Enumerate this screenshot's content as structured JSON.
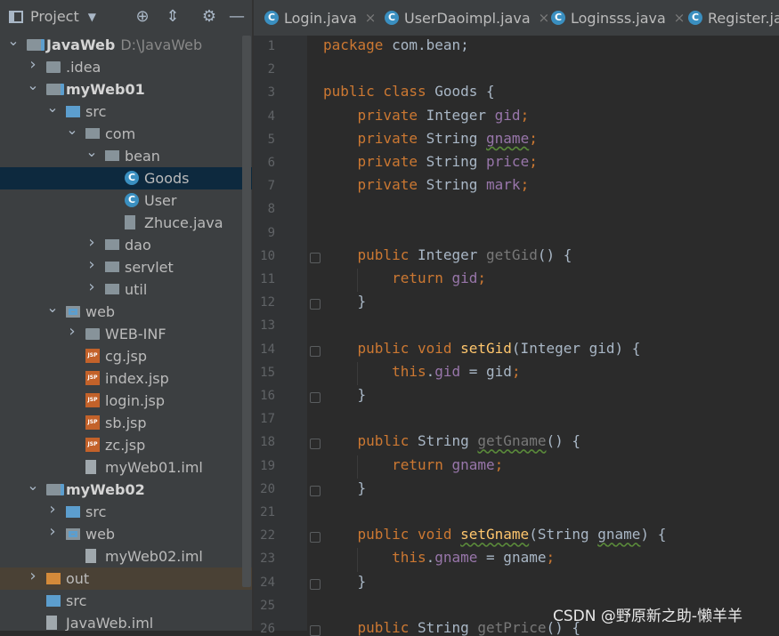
{
  "project_panel": {
    "title": "Project",
    "tree": [
      {
        "label": "JavaWeb",
        "path": "D:\\JavaWeb",
        "indent": 0,
        "expanded": true,
        "kind": "module-folder",
        "bold": true
      },
      {
        "label": ".idea",
        "indent": 1,
        "expanded": false,
        "kind": "folder"
      },
      {
        "label": "myWeb01",
        "indent": 1,
        "expanded": true,
        "kind": "module-folder",
        "bold": true
      },
      {
        "label": "src",
        "indent": 2,
        "expanded": true,
        "kind": "src-folder"
      },
      {
        "label": "com",
        "indent": 3,
        "expanded": true,
        "kind": "package"
      },
      {
        "label": "bean",
        "indent": 4,
        "expanded": true,
        "kind": "package"
      },
      {
        "label": "Goods",
        "indent": 5,
        "kind": "class",
        "selected": true
      },
      {
        "label": "User",
        "indent": 5,
        "kind": "class"
      },
      {
        "label": "Zhuce.java",
        "indent": 5,
        "kind": "java-file"
      },
      {
        "label": "dao",
        "indent": 4,
        "expanded": false,
        "kind": "package"
      },
      {
        "label": "servlet",
        "indent": 4,
        "expanded": false,
        "kind": "package"
      },
      {
        "label": "util",
        "indent": 4,
        "expanded": false,
        "kind": "package"
      },
      {
        "label": "web",
        "indent": 2,
        "expanded": true,
        "kind": "web-folder"
      },
      {
        "label": "WEB-INF",
        "indent": 3,
        "expanded": false,
        "kind": "folder"
      },
      {
        "label": "cg.jsp",
        "indent": 3,
        "kind": "jsp"
      },
      {
        "label": "index.jsp",
        "indent": 3,
        "kind": "jsp"
      },
      {
        "label": "login.jsp",
        "indent": 3,
        "kind": "jsp"
      },
      {
        "label": "sb.jsp",
        "indent": 3,
        "kind": "jsp"
      },
      {
        "label": "zc.jsp",
        "indent": 3,
        "kind": "jsp"
      },
      {
        "label": "myWeb01.iml",
        "indent": 3,
        "kind": "iml"
      },
      {
        "label": "myWeb02",
        "indent": 1,
        "expanded": true,
        "kind": "module-folder",
        "bold": true
      },
      {
        "label": "src",
        "indent": 2,
        "expanded": false,
        "kind": "src-folder"
      },
      {
        "label": "web",
        "indent": 2,
        "expanded": false,
        "kind": "web-folder"
      },
      {
        "label": "myWeb02.iml",
        "indent": 3,
        "kind": "iml"
      },
      {
        "label": "out",
        "indent": 1,
        "expanded": false,
        "kind": "out-folder",
        "highlight": true
      },
      {
        "label": "src",
        "indent": 1,
        "kind": "src-folder"
      },
      {
        "label": "JavaWeb.iml",
        "indent": 1,
        "kind": "iml"
      }
    ]
  },
  "tabs": [
    {
      "label": "Login.java"
    },
    {
      "label": "UserDaoimpl.java"
    },
    {
      "label": "Loginsss.java"
    },
    {
      "label": "Register.ja"
    }
  ],
  "editor": {
    "lines": [
      {
        "n": "1",
        "tokens": [
          {
            "t": "package ",
            "c": "kw"
          },
          {
            "t": "com.bean;",
            "c": ""
          }
        ]
      },
      {
        "n": "2",
        "tokens": []
      },
      {
        "n": "3",
        "tokens": [
          {
            "t": "public class ",
            "c": "kw"
          },
          {
            "t": "Goods {",
            "c": ""
          }
        ]
      },
      {
        "n": "4",
        "tokens": [
          {
            "t": "    private ",
            "c": "kw"
          },
          {
            "t": "Integer ",
            "c": ""
          },
          {
            "t": "gid",
            "c": "fld"
          },
          {
            "t": ";",
            "c": "kw"
          }
        ]
      },
      {
        "n": "5",
        "tokens": [
          {
            "t": "    private ",
            "c": "kw"
          },
          {
            "t": "String ",
            "c": ""
          },
          {
            "t": "gname",
            "c": "fld squig"
          },
          {
            "t": ";",
            "c": "kw"
          }
        ]
      },
      {
        "n": "6",
        "tokens": [
          {
            "t": "    private ",
            "c": "kw"
          },
          {
            "t": "String ",
            "c": ""
          },
          {
            "t": "price",
            "c": "fld"
          },
          {
            "t": ";",
            "c": "kw"
          }
        ]
      },
      {
        "n": "7",
        "tokens": [
          {
            "t": "    private ",
            "c": "kw"
          },
          {
            "t": "String ",
            "c": ""
          },
          {
            "t": "mark",
            "c": "fld"
          },
          {
            "t": ";",
            "c": "kw"
          }
        ]
      },
      {
        "n": "8",
        "tokens": []
      },
      {
        "n": "9",
        "tokens": []
      },
      {
        "n": "10",
        "tokens": [
          {
            "t": "    public ",
            "c": "kw"
          },
          {
            "t": "Integer ",
            "c": ""
          },
          {
            "t": "getGid",
            "c": "dim"
          },
          {
            "t": "() {",
            "c": ""
          }
        ]
      },
      {
        "n": "11",
        "tokens": [
          {
            "t": "        return ",
            "c": "kw"
          },
          {
            "t": "gid",
            "c": "fld"
          },
          {
            "t": ";",
            "c": "kw"
          }
        ]
      },
      {
        "n": "12",
        "tokens": [
          {
            "t": "    }",
            "c": ""
          }
        ]
      },
      {
        "n": "13",
        "tokens": []
      },
      {
        "n": "14",
        "tokens": [
          {
            "t": "    public void ",
            "c": "kw"
          },
          {
            "t": "setGid",
            "c": "mth"
          },
          {
            "t": "(Integer gid) {",
            "c": ""
          }
        ]
      },
      {
        "n": "15",
        "tokens": [
          {
            "t": "        this",
            "c": "kw"
          },
          {
            "t": ".",
            "c": ""
          },
          {
            "t": "gid",
            "c": "fld"
          },
          {
            "t": " = gid",
            "c": ""
          },
          {
            "t": ";",
            "c": "kw"
          }
        ]
      },
      {
        "n": "16",
        "tokens": [
          {
            "t": "    }",
            "c": ""
          }
        ]
      },
      {
        "n": "17",
        "tokens": []
      },
      {
        "n": "18",
        "tokens": [
          {
            "t": "    public ",
            "c": "kw"
          },
          {
            "t": "String ",
            "c": ""
          },
          {
            "t": "getGname",
            "c": "dim squig"
          },
          {
            "t": "() {",
            "c": ""
          }
        ]
      },
      {
        "n": "19",
        "tokens": [
          {
            "t": "        return ",
            "c": "kw"
          },
          {
            "t": "gname",
            "c": "fld"
          },
          {
            "t": ";",
            "c": "kw"
          }
        ]
      },
      {
        "n": "20",
        "tokens": [
          {
            "t": "    }",
            "c": ""
          }
        ]
      },
      {
        "n": "21",
        "tokens": []
      },
      {
        "n": "22",
        "tokens": [
          {
            "t": "    public void ",
            "c": "kw"
          },
          {
            "t": "setGname",
            "c": "mth squig"
          },
          {
            "t": "(String ",
            "c": ""
          },
          {
            "t": "gname",
            "c": "squig"
          },
          {
            "t": ") {",
            "c": ""
          }
        ]
      },
      {
        "n": "23",
        "tokens": [
          {
            "t": "        this",
            "c": "kw"
          },
          {
            "t": ".",
            "c": ""
          },
          {
            "t": "gname",
            "c": "fld"
          },
          {
            "t": " = gname",
            "c": ""
          },
          {
            "t": ";",
            "c": "kw"
          }
        ]
      },
      {
        "n": "24",
        "tokens": [
          {
            "t": "    }",
            "c": ""
          }
        ]
      },
      {
        "n": "25",
        "tokens": []
      },
      {
        "n": "26",
        "tokens": [
          {
            "t": "    public ",
            "c": "kw"
          },
          {
            "t": "String ",
            "c": ""
          },
          {
            "t": "getPrice",
            "c": "dim"
          },
          {
            "t": "() {",
            "c": ""
          }
        ]
      }
    ]
  },
  "watermark": "CSDN @野原新之助-懒羊羊"
}
